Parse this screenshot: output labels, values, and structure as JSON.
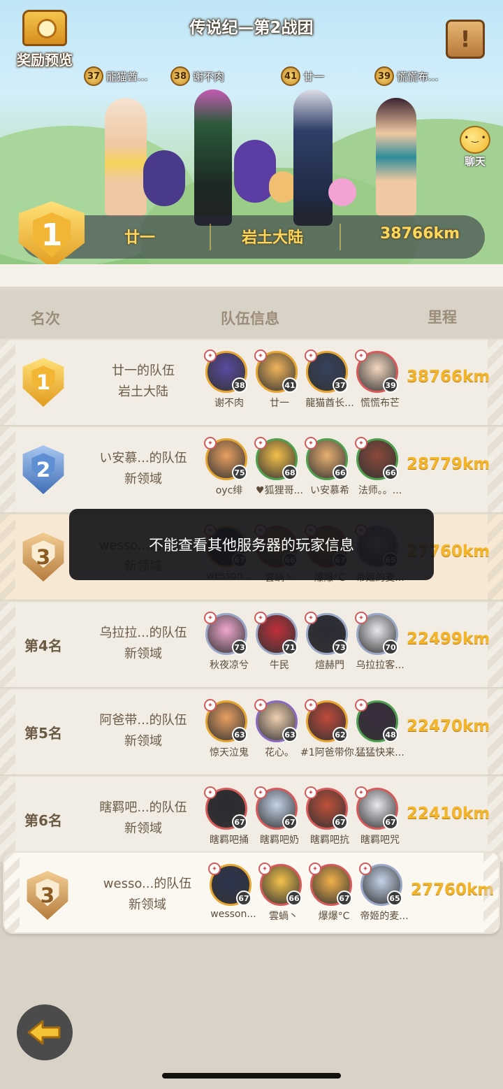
{
  "header": {
    "title": "传说纪—第2战团",
    "reward_label": "奖励预览",
    "chat_label": "聊天",
    "scroll_icon": "exclamation-scroll-icon"
  },
  "hero_members": [
    {
      "level": "37",
      "name": "龍猫酋..."
    },
    {
      "level": "38",
      "name": "谢不肉"
    },
    {
      "level": "41",
      "name": "廿一"
    },
    {
      "level": "39",
      "name": "慌慌布..."
    }
  ],
  "leader": {
    "rank": "1",
    "name": "廿一",
    "region": "岩土大陆",
    "distance": "38766km"
  },
  "table": {
    "col_rank": "名次",
    "col_team": "队伍信息",
    "col_distance": "里程"
  },
  "rows": [
    {
      "rank_medal": "1",
      "rank_text": "",
      "team": "廿一的队伍",
      "region": "岩土大陆",
      "distance": "38766km",
      "members": [
        {
          "name": "谢不肉",
          "level": "38"
        },
        {
          "name": "廿一",
          "level": "41"
        },
        {
          "name": "龍猫酋长...",
          "level": "37"
        },
        {
          "name": "慌慌布芒",
          "level": "39"
        }
      ]
    },
    {
      "rank_medal": "2",
      "rank_text": "",
      "team": "い安慕...的队伍",
      "region": "新领域",
      "distance": "28779km",
      "members": [
        {
          "name": "oyc绯",
          "level": "75"
        },
        {
          "name": "♥狐狸哥...",
          "level": "68"
        },
        {
          "name": "い安慕希",
          "level": "66"
        },
        {
          "name": "法师。。...",
          "level": "66"
        }
      ]
    },
    {
      "rank_medal": "3",
      "rank_text": "",
      "team": "wesso...的队伍",
      "region": "新领域",
      "distance": "27760km",
      "members": [
        {
          "name": "wesson...",
          "level": "67"
        },
        {
          "name": "雲蝸丶",
          "level": "66"
        },
        {
          "name": "爆爆°C",
          "level": "67"
        },
        {
          "name": "帝姬的麦...",
          "level": "65"
        }
      ]
    },
    {
      "rank_medal": "",
      "rank_text": "第4名",
      "team": "乌拉拉...的队伍",
      "region": "新领域",
      "distance": "22499km",
      "members": [
        {
          "name": "秋夜凉兮",
          "level": "73"
        },
        {
          "name": "牛民",
          "level": "71"
        },
        {
          "name": "煊赫門",
          "level": "73"
        },
        {
          "name": "乌拉拉客...",
          "level": "70"
        }
      ]
    },
    {
      "rank_medal": "",
      "rank_text": "第5名",
      "team": "阿爸带...的队伍",
      "region": "新领域",
      "distance": "22470km",
      "members": [
        {
          "name": "惊天泣鬼",
          "level": "63"
        },
        {
          "name": "花心。",
          "level": "63"
        },
        {
          "name": "#1阿爸带你...",
          "level": "62"
        },
        {
          "name": "猛猛快来...",
          "level": "48"
        }
      ]
    },
    {
      "rank_medal": "",
      "rank_text": "第6名",
      "team": "瞎羁吧...的队伍",
      "region": "新领域",
      "distance": "22410km",
      "members": [
        {
          "name": "瞎羁吧捅",
          "level": "67"
        },
        {
          "name": "瞎羁吧奶",
          "level": "67"
        },
        {
          "name": "瞎羁吧抗",
          "level": "67"
        },
        {
          "name": "瞎羁吧咒",
          "level": "67"
        }
      ]
    }
  ],
  "self_row": {
    "rank_medal": "3",
    "team": "wesso...的队伍",
    "region": "新领域",
    "distance": "27760km",
    "members": [
      {
        "name": "wesson...",
        "level": "67"
      },
      {
        "name": "雲蝸丶",
        "level": "66"
      },
      {
        "name": "爆爆°C",
        "level": "67"
      },
      {
        "name": "帝姬的麦...",
        "level": "65"
      }
    ]
  },
  "toast": "不能查看其他服务器的玩家信息",
  "back_icon": "arrow-left-icon",
  "colors": {
    "gold": "#f3b52a",
    "paper": "#f1ede5",
    "bg": "#d9d3c7"
  }
}
